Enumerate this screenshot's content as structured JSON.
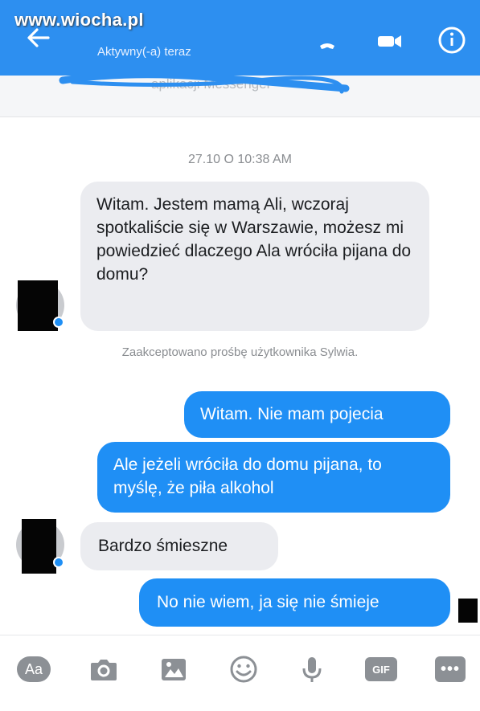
{
  "watermark": "www.wiocha.pl",
  "header": {
    "status": "Aktywny(-a) teraz",
    "icons": [
      "arrow-left-icon",
      "phone-icon",
      "video-camera-icon",
      "info-icon"
    ]
  },
  "notice": {
    "text": "aplikacji Messenger"
  },
  "conversation": {
    "timestamp": "27.10 O 10:38 AM",
    "system_note": "Zaakceptowano prośbę użytkownika Sylwia.",
    "messages": [
      {
        "side": "incoming",
        "text": "Witam. Jestem mamą Ali, wczoraj spotkaliście się w Warszawie, możesz mi powiedzieć dlaczego Ala wróciła pijana do domu?"
      },
      {
        "side": "outgoing",
        "text": "Witam. Nie mam pojecia"
      },
      {
        "side": "outgoing",
        "text": "Ale jeżeli wróciła do domu pijana, to myślę, że piła alkohol"
      },
      {
        "side": "incoming",
        "text": "Bardzo śmieszne"
      },
      {
        "side": "outgoing",
        "text": "No nie wiem, ja się nie śmieje"
      }
    ]
  },
  "composer": {
    "aa_label": "Aa",
    "gif_label": "GIF",
    "more_label": "•••",
    "icons": [
      "text-format-icon",
      "camera-icon",
      "image-icon",
      "emoji-icon",
      "microphone-icon",
      "gif-icon",
      "more-icon"
    ]
  },
  "colors": {
    "brand": "#2d8ff0",
    "outgoing_bubble": "#1f8ff5",
    "incoming_bubble": "#ebecf0"
  }
}
